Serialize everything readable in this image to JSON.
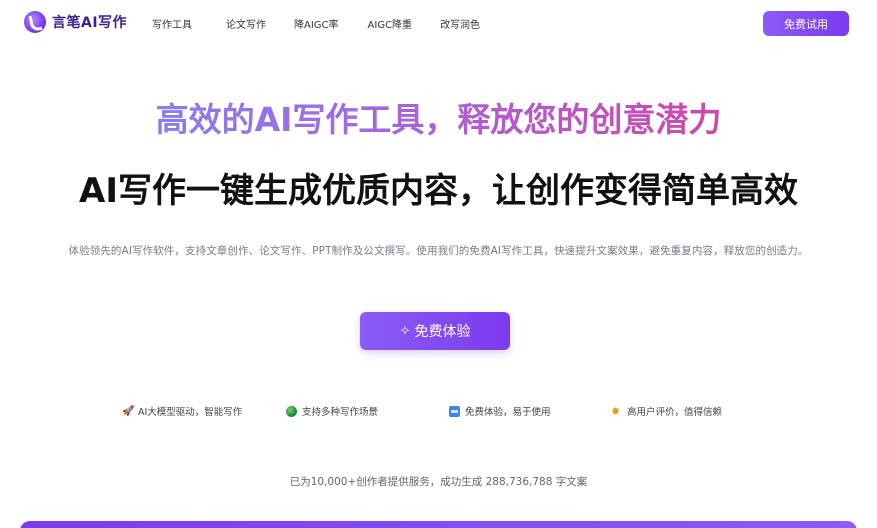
{
  "brand": {
    "name": "言笔AI写作",
    "logo_icon": "quill-logo-icon"
  },
  "nav": {
    "links": [
      "写作工具",
      "论文写作",
      "降AIGC率",
      "AIGC降重",
      "改写润色"
    ],
    "cta_label": "免费试用"
  },
  "hero": {
    "gradient_title": "高效的AI写作工具，释放您的创意潜力",
    "title": "AI写作一键生成优质内容，让创作变得简单高效",
    "description": "体验领先的AI写作软件，支持文章创作、论文写作、PPT制作及公文撰写。使用我们的免费AI写作工具，快速提升文案效果，避免重复内容，释放您的创造力。",
    "cta_label": "免费体验",
    "cta_icon": "sparkle-icon"
  },
  "features": [
    {
      "icon": "rocket-icon",
      "label": "AI大模型驱动，智能写作"
    },
    {
      "icon": "globe-icon",
      "label": "支持多种写作场景"
    },
    {
      "icon": "free-icon",
      "label": "免费体验，易于使用"
    },
    {
      "icon": "star-icon",
      "label": "高用户评价，值得信赖"
    }
  ],
  "stats": "已为10,000+创作者提供服务，成功生成 288,736,788 字文案",
  "colors": {
    "accent": "#7c3aed",
    "gradient_start": "#7c8cf0",
    "gradient_end": "#e0408a"
  }
}
